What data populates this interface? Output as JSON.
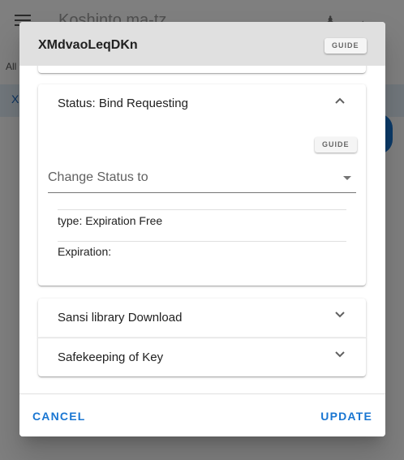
{
  "background": {
    "app_title": "Koshinto ma-tz",
    "all_label": "All",
    "row_label": "X"
  },
  "dialog": {
    "title": "XMdvaoLeqDKn",
    "guide_label": "GUIDE",
    "status_panel": {
      "title": "Status: Bind Requesting",
      "guide_label": "GUIDE",
      "change_status_placeholder": "Change Status to",
      "type_text": "type: Expiration Free",
      "expiration_text": "Expiration:"
    },
    "panels": [
      {
        "title": "Sansi library Download"
      },
      {
        "title": "Safekeeping of Key"
      }
    ],
    "cancel_label": "CANCEL",
    "update_label": "UPDATE"
  },
  "colors": {
    "accent": "#1976d2",
    "header_bg": "#e0e0e0",
    "scrim": "rgba(0,0,0,0.5)"
  },
  "icons": {
    "menu": "menu-icon",
    "person": "person-icon",
    "back": "arrow-back-icon",
    "expand_less": "chevron-up-icon",
    "expand_more": "chevron-down-icon",
    "dropdown": "dropdown-arrow-icon"
  }
}
